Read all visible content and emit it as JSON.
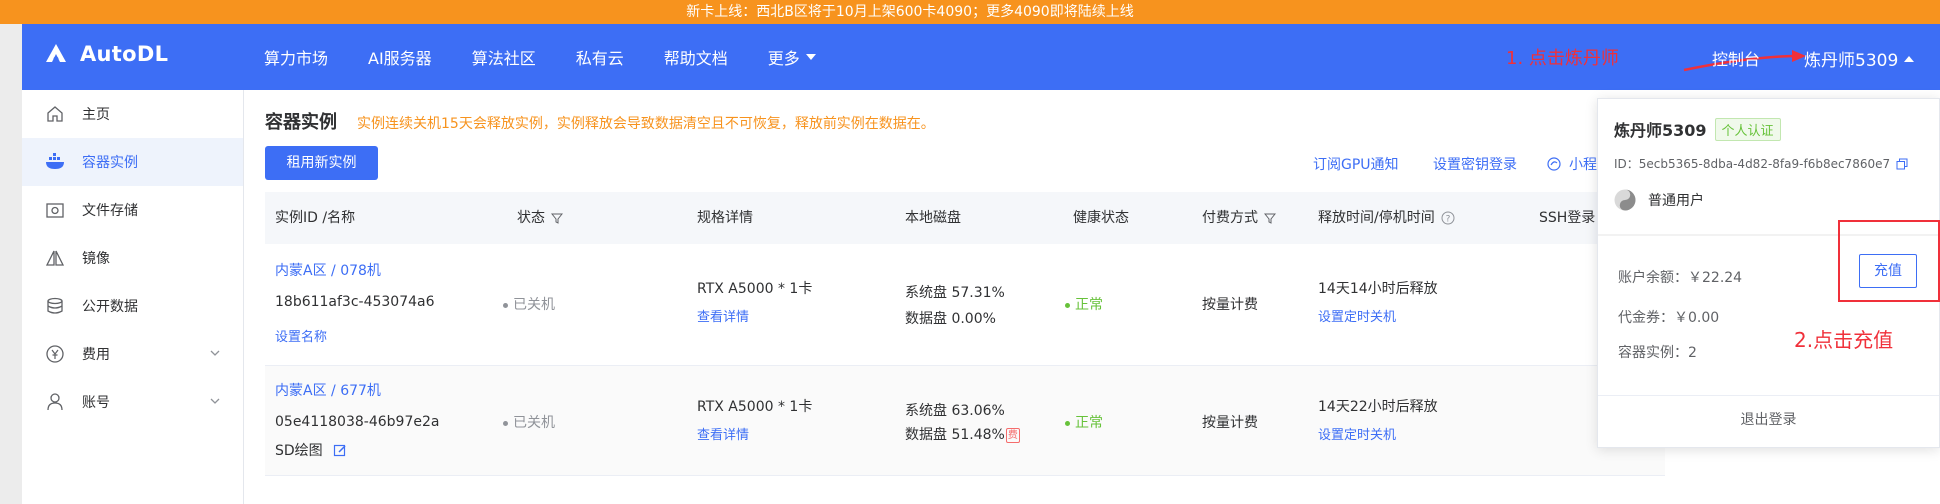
{
  "banner": {
    "text": "新卡上线：西北B区将于10月上架600卡4090；更多4090即将陆续上线"
  },
  "nav": {
    "logo": "AutoDL",
    "items": [
      "算力市场",
      "AI服务器",
      "算法社区",
      "私有云",
      "帮助文档"
    ],
    "more": "更多",
    "console": "控制台",
    "username": "炼丹师5309",
    "annotation": "1. 点击炼丹师"
  },
  "sidebar": {
    "items": [
      {
        "label": "主页",
        "icon": "home-icon"
      },
      {
        "label": "容器实例",
        "icon": "container-icon"
      },
      {
        "label": "文件存储",
        "icon": "storage-icon"
      },
      {
        "label": "镜像",
        "icon": "image-icon"
      },
      {
        "label": "公开数据",
        "icon": "database-icon"
      },
      {
        "label": "费用",
        "icon": "yen-icon"
      },
      {
        "label": "账号",
        "icon": "user-icon"
      }
    ]
  },
  "main": {
    "title": "容器实例",
    "warning": "实例连续关机15天会释放实例，实例释放会导致数据清空且不可恢复，释放前实例在数据在。",
    "rent_button": "租用新实例",
    "links": {
      "subscribe": "订阅GPU通知",
      "ssh_key": "设置密钥登录",
      "mini": "小程"
    },
    "columns": [
      "实例ID /名称",
      "状态",
      "规格详情",
      "本地磁盘",
      "健康状态",
      "付费方式",
      "释放时间/停机时间",
      "SSH登录"
    ],
    "rows": [
      {
        "region": "内蒙A区 / 078机",
        "id": "18b611af3c-453074a6",
        "name_action": "设置名称",
        "status": "已关机",
        "spec": "RTX A5000 * 1卡",
        "spec_link": "查看详情",
        "disk_system": "系统盘 57.31%",
        "disk_data": "数据盘 0.00%",
        "health": "正常",
        "billing": "按量计费",
        "release": "14天14小时后释放",
        "release_link": "设置定时关机"
      },
      {
        "region": "内蒙A区 / 677机",
        "id": "05e4118038-46b97e2a",
        "name_action": "SD绘图",
        "status": "已关机",
        "spec": "RTX A5000 * 1卡",
        "spec_link": "查看详情",
        "disk_system": "系统盘 63.06%",
        "disk_data": "数据盘 51.48%",
        "disk_badge": "费",
        "health": "正常",
        "billing": "按量计费",
        "release": "14天22小时后释放",
        "release_link": "设置定时关机"
      }
    ]
  },
  "popover": {
    "name": "炼丹师5309",
    "cert": "个人认证",
    "id": "ID：5ecb5365-8dba-4d82-8fa9-f6b8ec7860e7",
    "user_type": "普通用户",
    "balance": "账户余额：￥22.24",
    "recharge": "充值",
    "voucher": "代金券：￥0.00",
    "instances": "容器实例：2",
    "logout": "退出登录",
    "annotation": "2.点击充值"
  },
  "colors": {
    "brand": "#3d6ef5",
    "banner": "#f7931e",
    "annotation": "#f0303a",
    "healthy": "#67c23a"
  }
}
